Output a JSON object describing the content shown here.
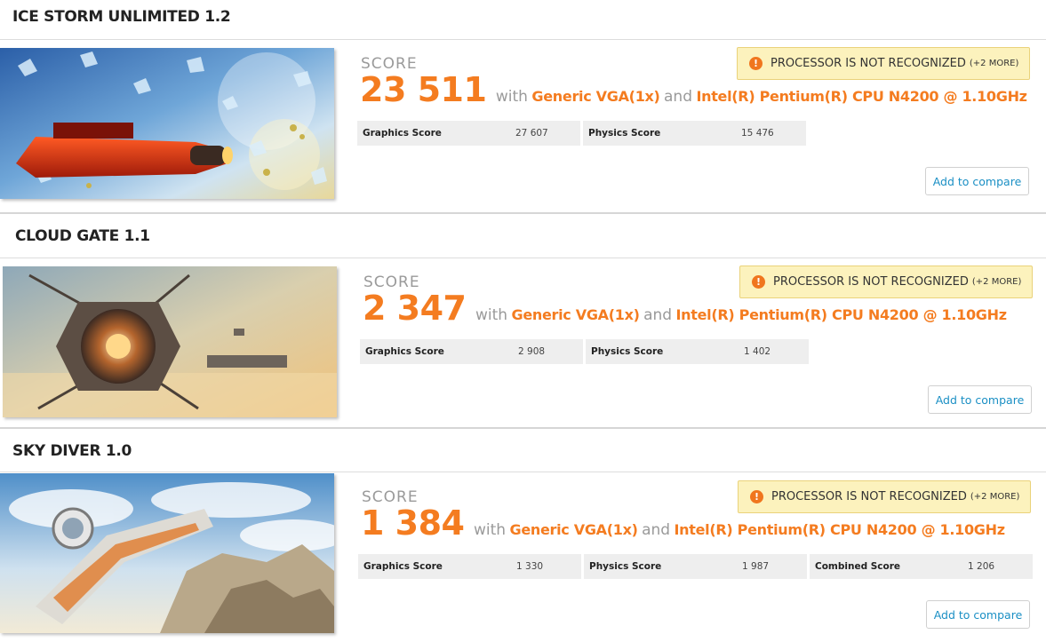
{
  "score_label": "SCORE",
  "with_text": "with",
  "and_text": "and",
  "compare_label": "Add to compare",
  "warning": {
    "icon": "warning-icon",
    "text": "PROCESSOR IS NOT RECOGNIZED",
    "more": "(+2 MORE)"
  },
  "colors": {
    "accent": "#f47c20",
    "link": "#1a8fc4",
    "warning_bg": "#fcf2bd"
  },
  "benchmarks": [
    {
      "title": "ICE STORM UNLIMITED 1.2",
      "score": "23 511",
      "gpu": "Generic VGA(1x)",
      "cpu": "Intel(R) Pentium(R) CPU N4200 @ 1.10GHz",
      "subscores": [
        {
          "name": "Graphics Score",
          "value": "27 607"
        },
        {
          "name": "Physics Score",
          "value": "15 476"
        }
      ]
    },
    {
      "title": "CLOUD GATE 1.1",
      "score": "2 347",
      "gpu": "Generic VGA(1x)",
      "cpu": "Intel(R) Pentium(R) CPU N4200 @ 1.10GHz",
      "subscores": [
        {
          "name": "Graphics Score",
          "value": "2 908"
        },
        {
          "name": "Physics Score",
          "value": "1 402"
        }
      ]
    },
    {
      "title": "SKY DIVER 1.0",
      "score": "1 384",
      "gpu": "Generic VGA(1x)",
      "cpu": "Intel(R) Pentium(R) CPU N4200 @ 1.10GHz",
      "subscores": [
        {
          "name": "Graphics Score",
          "value": "1 330"
        },
        {
          "name": "Physics Score",
          "value": "1 987"
        },
        {
          "name": "Combined Score",
          "value": "1 206"
        }
      ]
    }
  ]
}
